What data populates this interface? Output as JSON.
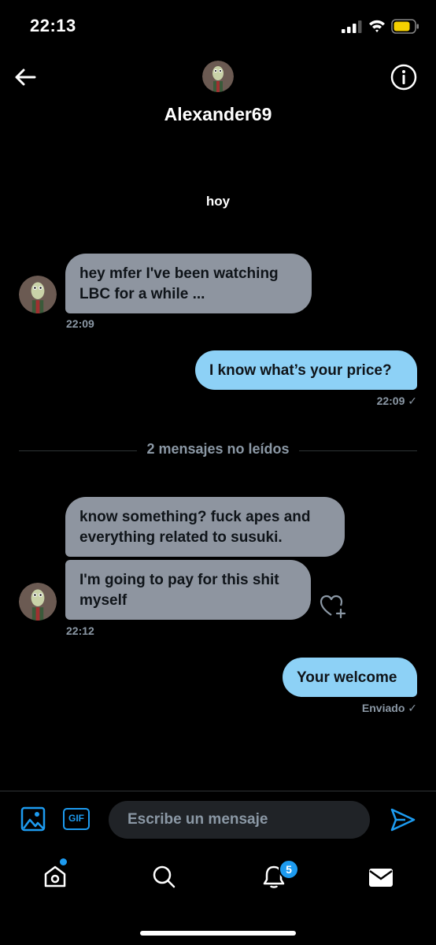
{
  "status_bar": {
    "time": "22:13"
  },
  "header": {
    "name": "Alexander69"
  },
  "date_separator": "hoy",
  "messages": [
    {
      "side": "in",
      "text_lines": [
        "hey mfer I've been watching",
        "LBC for a while ..."
      ],
      "time": "22:09"
    },
    {
      "side": "out",
      "text": "I know what’s your price?",
      "time": "22:09 ✓"
    },
    {
      "side": "in",
      "text_lines": [
        "know something? fuck apes and",
        "everything related to susuki."
      ]
    },
    {
      "side": "in",
      "text_lines": [
        "I'm going to pay for this shit",
        "myself"
      ],
      "time": "22:12"
    },
    {
      "side": "out",
      "text": "Your welcome",
      "status": "Enviado ✓"
    }
  ],
  "unread_divider": "2 mensajes no leídos",
  "composer": {
    "placeholder": "Escribe un mensaje",
    "gif_label": "GIF"
  },
  "bottom_nav": {
    "notifications_badge": "5"
  },
  "colors": {
    "accent": "#1d9bf0",
    "incoming_bubble": "#8e95a0",
    "outgoing_bubble": "#8dd1f6"
  }
}
